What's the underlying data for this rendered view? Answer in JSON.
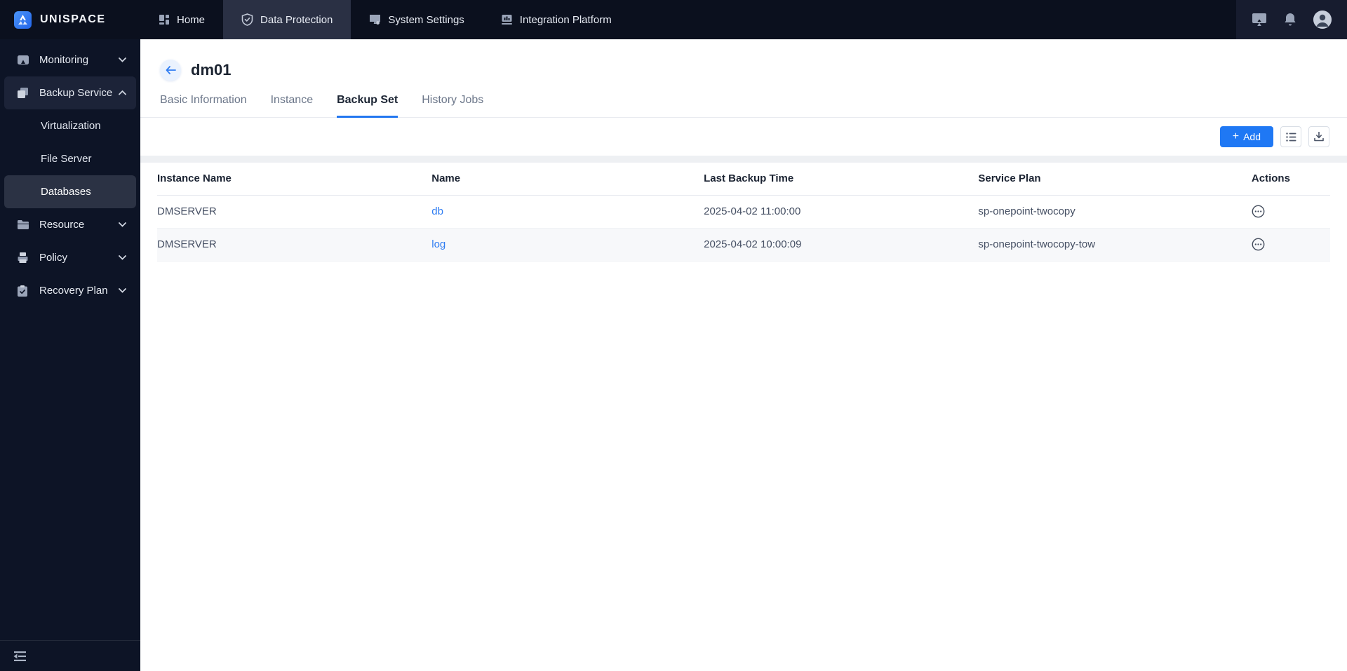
{
  "brand": {
    "name": "UNISPACE"
  },
  "topnav": {
    "items": [
      {
        "label": "Home",
        "icon": "dashboard-icon"
      },
      {
        "label": "Data Protection",
        "icon": "shield-check-icon"
      },
      {
        "label": "System Settings",
        "icon": "monitor-icon"
      },
      {
        "label": "Integration Platform",
        "icon": "chart-board-icon"
      }
    ],
    "active": "Data Protection"
  },
  "sidebar": {
    "items": [
      {
        "label": "Monitoring",
        "state": "collapsed"
      },
      {
        "label": "Backup Service",
        "state": "expanded",
        "children": [
          "Virtualization",
          "File Server",
          "Databases"
        ],
        "selected_child": "Databases"
      },
      {
        "label": "Resource",
        "state": "collapsed"
      },
      {
        "label": "Policy",
        "state": "collapsed"
      },
      {
        "label": "Recovery Plan",
        "state": "collapsed"
      }
    ]
  },
  "page": {
    "title": "dm01",
    "tabs": [
      {
        "label": "Basic Information",
        "active": false
      },
      {
        "label": "Instance",
        "active": false
      },
      {
        "label": "Backup Set",
        "active": true
      },
      {
        "label": "History Jobs",
        "active": false
      }
    ],
    "toolbar": {
      "add_plus": "+",
      "add_label": "Add"
    }
  },
  "table": {
    "columns": [
      "Instance Name",
      "Name",
      "Last Backup Time",
      "Service Plan",
      "Actions"
    ],
    "rows": [
      {
        "instance_name": "DMSERVER",
        "name": "db",
        "last_backup_time": "2025-04-02 11:00:00",
        "service_plan": "sp-onepoint-twocopy"
      },
      {
        "instance_name": "DMSERVER",
        "name": "log",
        "last_backup_time": "2025-04-02 10:00:09",
        "service_plan": "sp-onepoint-twocopy-tow"
      }
    ]
  },
  "colors": {
    "accent_blue": "#1f78f4",
    "link_blue": "#2e7cf2",
    "topbar_bg": "#0b101e",
    "sidebar_bg": "#0d1426",
    "active_nav_bg": "#2a3044",
    "selected_item_bg": "#2b3244",
    "zebra_row_bg": "#f7f8fa"
  }
}
